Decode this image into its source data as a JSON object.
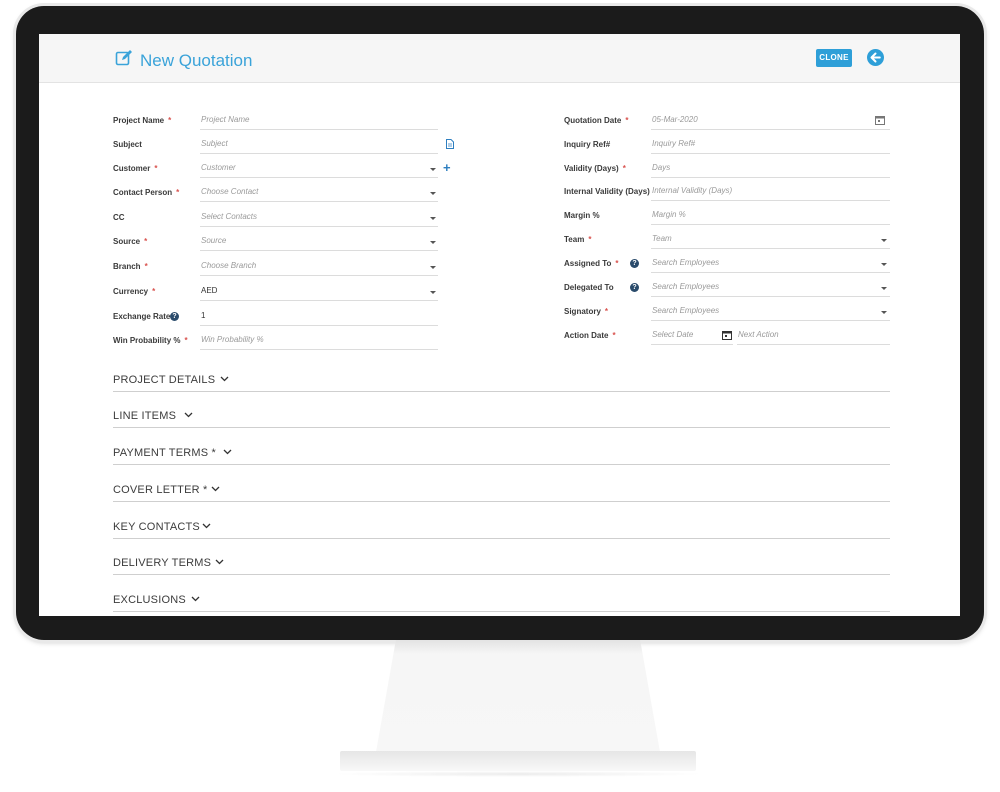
{
  "header": {
    "title": "New Quotation",
    "clone_label": "CLONE"
  },
  "left_fields": [
    {
      "label": "Project Name",
      "required": "*",
      "placeholder": "Project Name"
    },
    {
      "label": "Subject",
      "placeholder": "Subject"
    },
    {
      "label": "Customer",
      "required": "*",
      "placeholder": "Customer"
    },
    {
      "label": "Contact Person",
      "required": "*",
      "placeholder": "Choose Contact"
    },
    {
      "label": "CC",
      "placeholder": "Select Contacts"
    },
    {
      "label": "Source",
      "required": "*",
      "placeholder": "Source"
    },
    {
      "label": "Branch",
      "required": "*",
      "placeholder": "Choose Branch"
    },
    {
      "label": "Currency",
      "required": "*",
      "value": "AED"
    },
    {
      "label": "Exchange Rate",
      "help": "?",
      "value": "1"
    },
    {
      "label": "Win Probability %",
      "required": "*",
      "placeholder": "Win Probability %"
    }
  ],
  "right_fields": [
    {
      "label": "Quotation Date",
      "required": "*",
      "placeholder": "05-Mar-2020"
    },
    {
      "label": "Inquiry Ref#",
      "placeholder": "Inquiry Ref#"
    },
    {
      "label": "Validity (Days)",
      "required": "*",
      "placeholder": "Days"
    },
    {
      "label": "Internal Validity (Days)",
      "placeholder": "Internal Validity (Days)"
    },
    {
      "label": "Margin %",
      "placeholder": "Margin %"
    },
    {
      "label": "Team",
      "required": "*",
      "placeholder": "Team"
    },
    {
      "label": "Assigned To",
      "required": "*",
      "help": "?",
      "placeholder": "Search Employees"
    },
    {
      "label": "Delegated To",
      "help": "?",
      "placeholder": "Search Employees"
    },
    {
      "label": "Signatory",
      "required": "*",
      "placeholder": "Search Employees"
    },
    {
      "label": "Action Date",
      "required": "*",
      "placeholder": "Select Date",
      "placeholder2": "Next Action"
    }
  ],
  "sections": [
    {
      "title": "PROJECT DETAILS"
    },
    {
      "title": "LINE ITEMS"
    },
    {
      "title": "PAYMENT TERMS *"
    },
    {
      "title": "COVER LETTER *"
    },
    {
      "title": "KEY CONTACTS"
    },
    {
      "title": "DELIVERY TERMS"
    },
    {
      "title": "EXCLUSIONS"
    }
  ],
  "icons": {
    "title": "edit-icon",
    "back": "arrow-left-circle-icon",
    "subject": "document-icon",
    "customer_add": "plus-icon",
    "calendar": "calendar-icon",
    "dropdown": "chevron-down-icon"
  },
  "colors": {
    "accent": "#2e9fd8",
    "title": "#3aa3d9",
    "required": "#d9534f",
    "help": "#2a4b6b"
  }
}
